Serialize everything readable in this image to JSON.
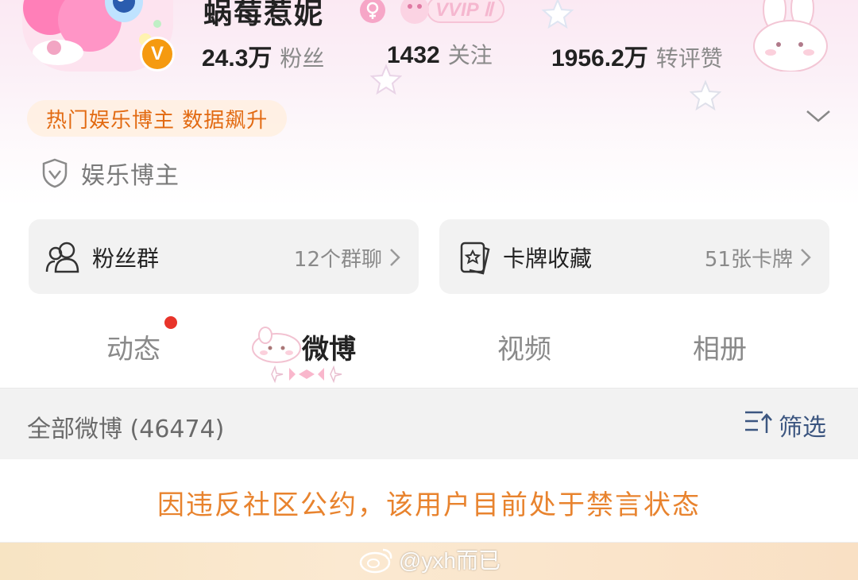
{
  "profile": {
    "username": "蜗莓惹妮",
    "vip_label": "VVIP Ⅱ",
    "verified_badge": "V",
    "stats": [
      {
        "num": "24.3万",
        "label": "粉丝"
      },
      {
        "num": "1432",
        "label": "关注"
      },
      {
        "num": "1956.2万",
        "label": "转评赞"
      }
    ],
    "hot_tag": "热门娱乐博主 数据飙升",
    "certification": "娱乐博主"
  },
  "cards": [
    {
      "title": "粉丝群",
      "sub": "12个群聊",
      "icon": "fan-group-icon"
    },
    {
      "title": "卡牌收藏",
      "sub": "51张卡牌",
      "icon": "card-collection-icon"
    }
  ],
  "tabs": [
    {
      "label": "动态",
      "active": false,
      "badge": "red-dot"
    },
    {
      "label": "微博",
      "active": true
    },
    {
      "label": "视频",
      "active": false
    },
    {
      "label": "相册",
      "active": false
    }
  ],
  "feed": {
    "title": "全部微博 (46474)",
    "filter_label": "筛选",
    "notice": "因违反社区公约，该用户目前处于禁言状态"
  },
  "watermark": "@yxh而已",
  "colors": {
    "accent_orange": "#e8832e",
    "verified_orange": "#f59a10",
    "link_blue": "#3c5680",
    "dot_red": "#e8342a"
  }
}
